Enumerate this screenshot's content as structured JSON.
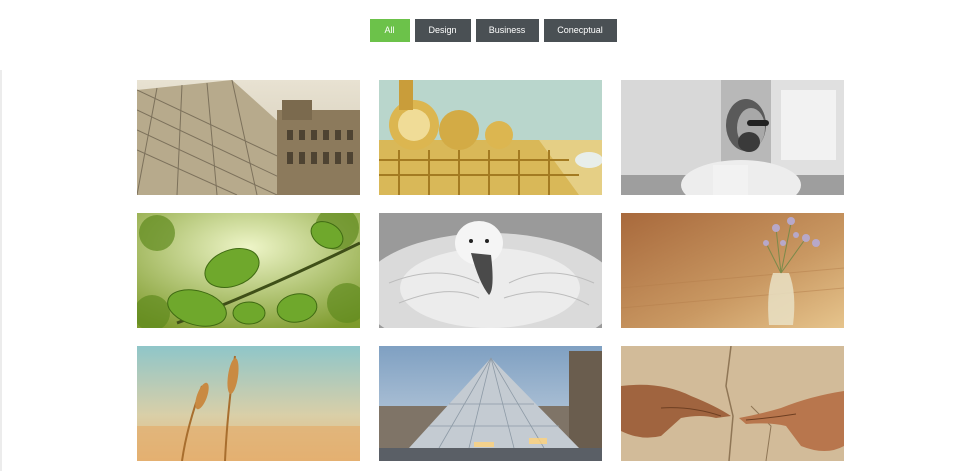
{
  "filters": [
    {
      "label": "All",
      "active": true
    },
    {
      "label": "Design",
      "active": false
    },
    {
      "label": "Business",
      "active": false
    },
    {
      "label": "Conecptual",
      "active": false
    }
  ],
  "colors": {
    "active_filter": "#6cc24a",
    "inactive_filter": "#4a5054",
    "filter_text": "#ffffff",
    "background": "#ffffff"
  },
  "gallery": [
    {
      "subject": "glass pyramid and palace, sepia"
    },
    {
      "subject": "golden ornate gate"
    },
    {
      "subject": "man with sunglasses, black and white"
    },
    {
      "subject": "green leaves against sky"
    },
    {
      "subject": "white swan resting"
    },
    {
      "subject": "flowers in glass vase on wood"
    },
    {
      "subject": "wheat ears at sunset"
    },
    {
      "subject": "glass pyramid at dusk"
    },
    {
      "subject": "two hands reaching, fresco"
    }
  ]
}
